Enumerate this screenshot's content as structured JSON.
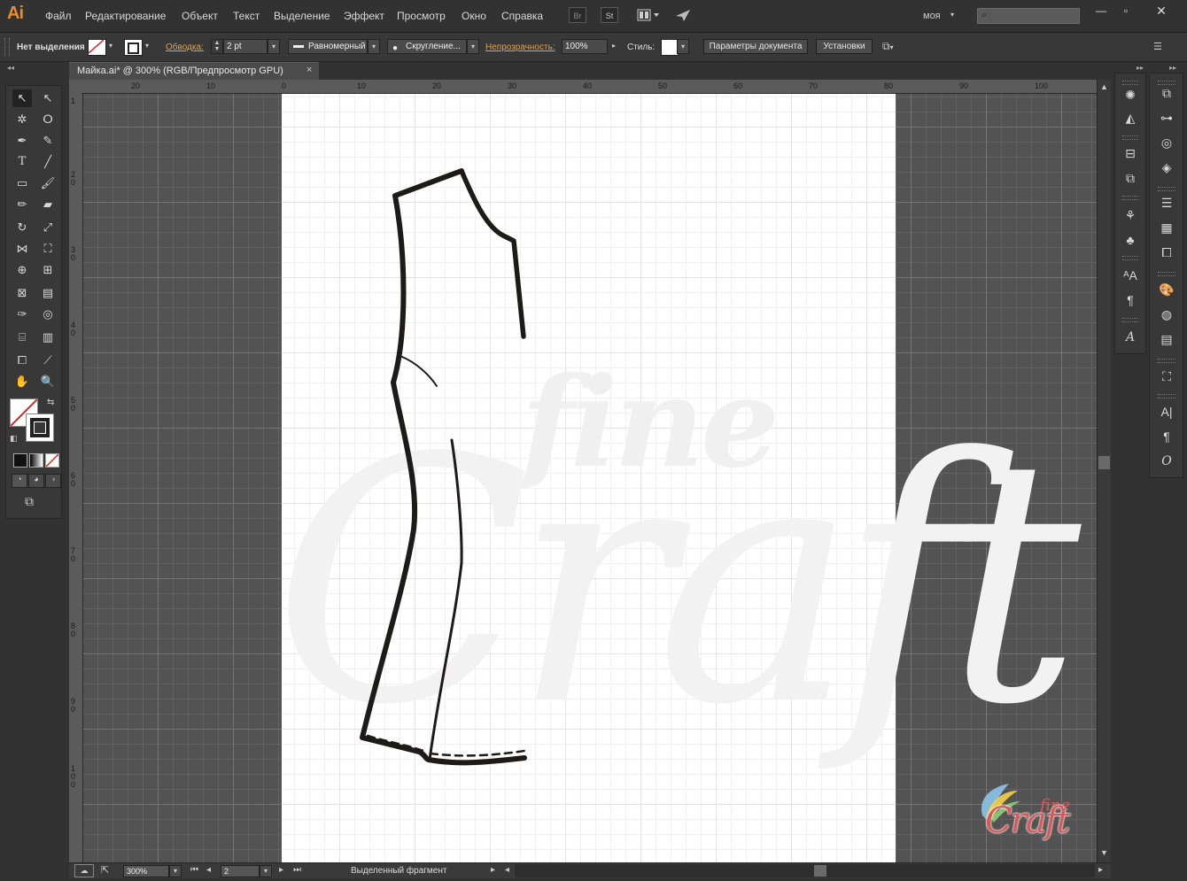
{
  "menubar": {
    "logo": "Ai",
    "items": [
      "Файл",
      "Редактирование",
      "Объект",
      "Текст",
      "Выделение",
      "Эффект",
      "Просмотр",
      "Окно",
      "Справка"
    ],
    "bridge": "Br",
    "stock": "St",
    "workspace": "моя",
    "search_placeholder": ""
  },
  "controlbar": {
    "selection_label": "Нет выделения",
    "stroke_label": "Обводка:",
    "stroke_weight": "2 pt",
    "profile": "Равномерный",
    "brush": "Скругление...",
    "opacity_label": "Непрозрачность:",
    "opacity_value": "100%",
    "style_label": "Стиль:",
    "doc_settings_button": "Параметры документа",
    "prefs_button": "Установки"
  },
  "document": {
    "tab_title": "Майка.ai* @ 300% (RGB/Предпросмотр GPU)",
    "close": "×"
  },
  "ruler_top": [
    "20",
    "10",
    "0",
    "10",
    "20",
    "30",
    "40",
    "50",
    "60",
    "70",
    "80",
    "90",
    "100"
  ],
  "ruler_left": [
    "1",
    "2\n0",
    "3\n0",
    "4\n0",
    "5\n0",
    "6\n0",
    "7\n0",
    "8\n0",
    "9\n0",
    "1\n0\n0"
  ],
  "status": {
    "zoom": "300%",
    "artboard_num": "2",
    "status_text": "Выделенный фрагмент"
  },
  "watermark": {
    "line1": "fine",
    "line2": "Craft"
  },
  "logo_badge": {
    "small": "fine",
    "large": "Craft"
  },
  "colors": {
    "accent_orange": "#e8a23c",
    "logo_pink": "#d65a5a"
  }
}
